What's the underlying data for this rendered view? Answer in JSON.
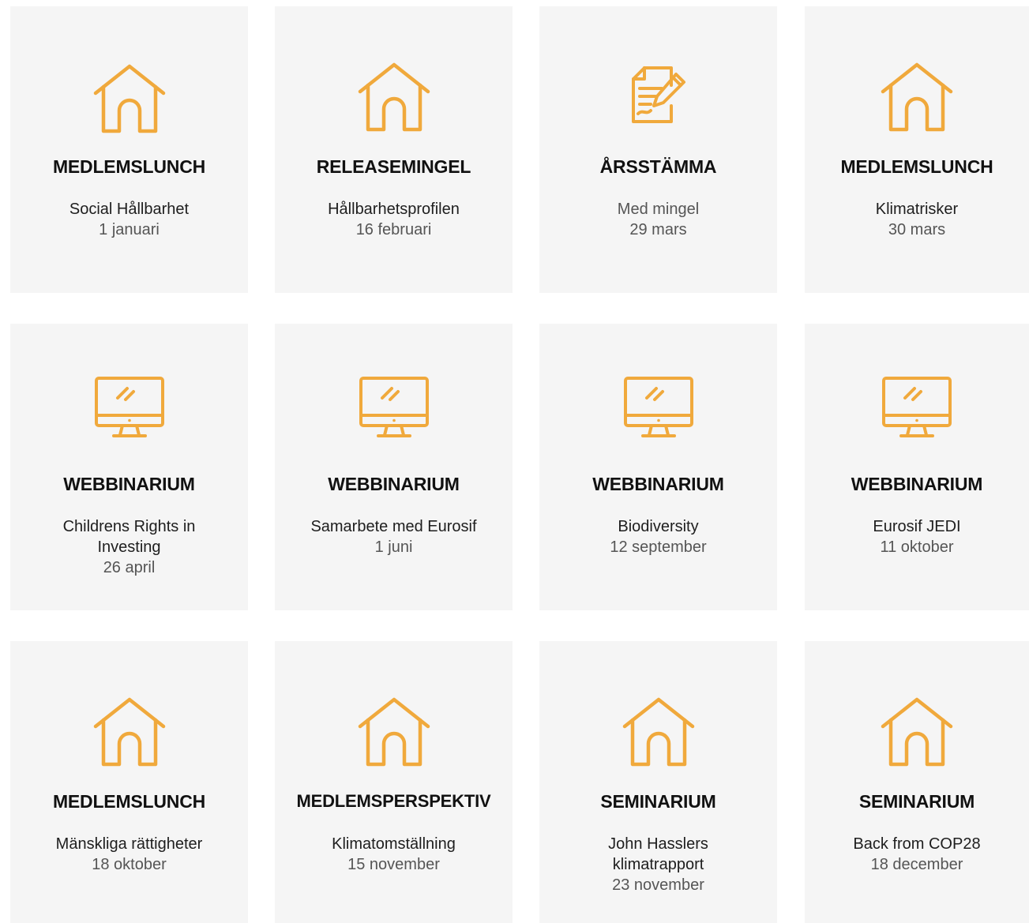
{
  "accent_color": "#f0a93c",
  "events": [
    {
      "icon": "house-icon",
      "title": "MEDLEMSLUNCH",
      "subtitle": "Social Hållbarhet",
      "date": "1 januari"
    },
    {
      "icon": "house-icon",
      "title": "RELEASEMINGEL",
      "subtitle": "Hållbarhetsprofilen",
      "date": "16 februari"
    },
    {
      "icon": "document-pen-icon",
      "title": "ÅRSSTÄMMA",
      "subtitle": "Med mingel",
      "date": "29 mars"
    },
    {
      "icon": "house-icon",
      "title": "MEDLEMSLUNCH",
      "subtitle": "Klimatrisker",
      "date": "30 mars"
    },
    {
      "icon": "monitor-icon",
      "title": "WEBBINARIUM",
      "subtitle": "Childrens Rights in Investing",
      "date": "26 april"
    },
    {
      "icon": "monitor-icon",
      "title": "WEBBINARIUM",
      "subtitle": "Samarbete med Eurosif",
      "date": "1 juni"
    },
    {
      "icon": "monitor-icon",
      "title": "WEBBINARIUM",
      "subtitle": "Biodiversity",
      "date": "12 september"
    },
    {
      "icon": "monitor-icon",
      "title": "WEBBINARIUM",
      "subtitle": "Eurosif JEDI",
      "date": "11 oktober"
    },
    {
      "icon": "house-icon",
      "title": "MEDLEMSLUNCH",
      "subtitle": "Mänskliga rättigheter",
      "date": "18 oktober"
    },
    {
      "icon": "house-icon",
      "title": "MEDLEMSPERSPEKTIV",
      "subtitle": "Klimatomställning",
      "date": "15 november"
    },
    {
      "icon": "house-icon",
      "title": "SEMINARIUM",
      "subtitle": "John Hasslers klimatrapport",
      "date": "23 november"
    },
    {
      "icon": "house-icon",
      "title": "SEMINARIUM",
      "subtitle": "Back from COP28",
      "date": "18 december"
    }
  ]
}
